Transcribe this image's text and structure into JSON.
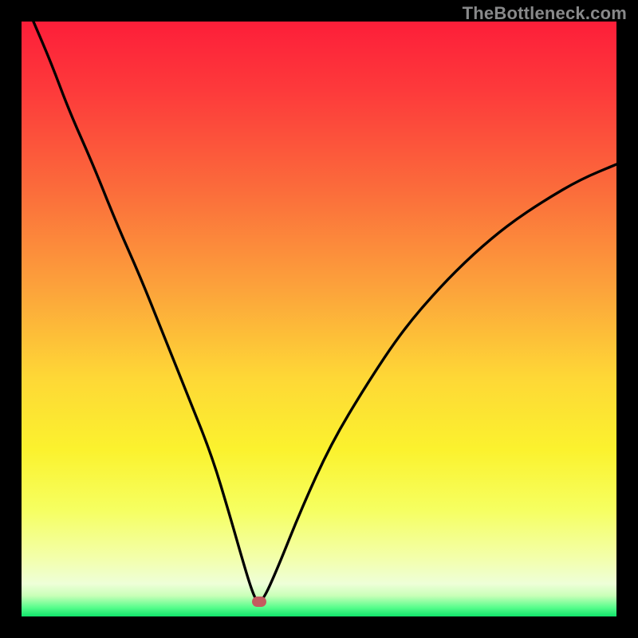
{
  "watermark": "TheBottleneck.com",
  "gradient_stops": [
    {
      "offset": 0.0,
      "color": "#fd1e39"
    },
    {
      "offset": 0.12,
      "color": "#fd3b3b"
    },
    {
      "offset": 0.28,
      "color": "#fb6b3b"
    },
    {
      "offset": 0.45,
      "color": "#fca33b"
    },
    {
      "offset": 0.6,
      "color": "#fed836"
    },
    {
      "offset": 0.72,
      "color": "#fbf22e"
    },
    {
      "offset": 0.82,
      "color": "#f6ff60"
    },
    {
      "offset": 0.9,
      "color": "#f3ffa9"
    },
    {
      "offset": 0.945,
      "color": "#eeffd8"
    },
    {
      "offset": 0.965,
      "color": "#c9ffb8"
    },
    {
      "offset": 0.985,
      "color": "#57fd8c"
    },
    {
      "offset": 1.0,
      "color": "#11e36a"
    }
  ],
  "chart_data": {
    "type": "line",
    "title": "",
    "xlabel": "",
    "ylabel": "",
    "xlim": [
      0,
      100
    ],
    "ylim": [
      0,
      100
    ],
    "series": [
      {
        "name": "bottleneck-curve",
        "x": [
          2,
          5,
          8,
          12,
          16,
          20,
          24,
          28,
          32,
          35,
          37,
          38.5,
          39.5,
          40.5,
          43,
          47,
          52,
          58,
          64,
          70,
          76,
          82,
          88,
          94,
          100
        ],
        "y": [
          100,
          93,
          85,
          76,
          66,
          57,
          47,
          37,
          27,
          17,
          10,
          5,
          2.5,
          2.5,
          8,
          18,
          29,
          39,
          48,
          55,
          61,
          66,
          70,
          73.5,
          76
        ]
      }
    ],
    "marker": {
      "x": 40,
      "y": 2.5
    },
    "grid": false,
    "legend": false
  }
}
